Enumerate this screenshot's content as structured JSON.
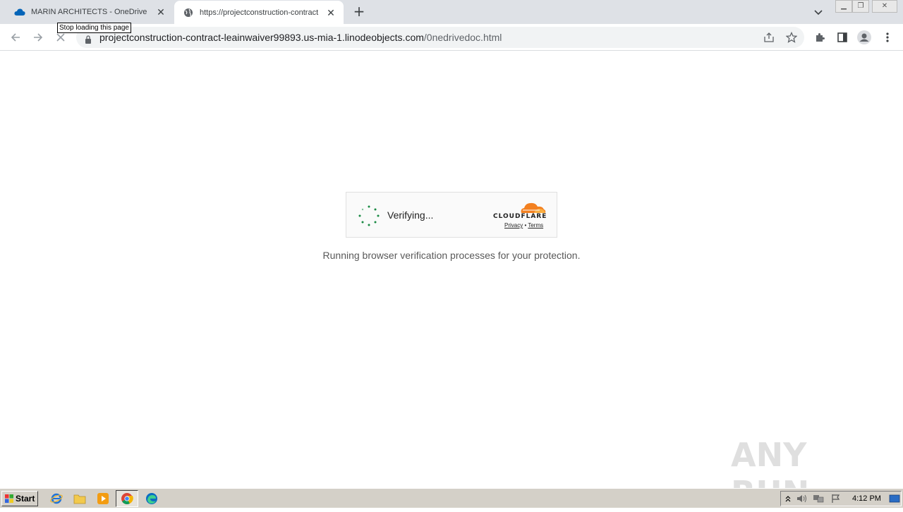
{
  "tabs": [
    {
      "title": "MARIN ARCHITECTS - OneDrive",
      "icon": "onedrive-icon",
      "active": false
    },
    {
      "title": "https://projectconstruction-contract",
      "icon": "globe-icon",
      "active": true
    }
  ],
  "tooltip": "Stop loading this page",
  "address": {
    "host": "projectconstruction-contract-leainwaiver99893.us-mia-1.linodeobjects.com",
    "path": "/0nedrivedoc.html"
  },
  "challenge": {
    "status": "Verifying...",
    "brand": "CLOUDFLARE",
    "privacy": "Privacy",
    "separator": "•",
    "terms": "Terms",
    "message": "Running browser verification processes for your protection."
  },
  "watermark": "ANY RUN",
  "taskbar": {
    "start_label": "Start",
    "clock": "4:12 PM"
  },
  "colors": {
    "cloudflare_orange": "#f38020",
    "spinner_green": "#1a8a43",
    "tab_strip": "#dee1e6",
    "taskbar": "#d4d0c8"
  }
}
